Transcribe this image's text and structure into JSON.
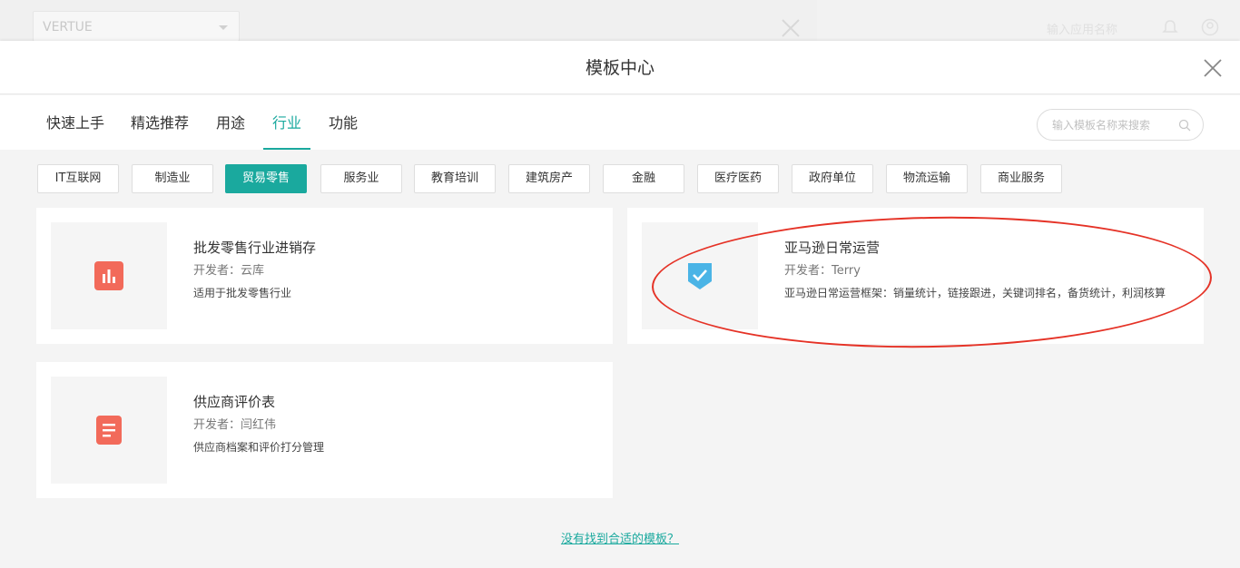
{
  "background": {
    "app_selector": "VERTUE",
    "search_placeholder": "输入应用名称"
  },
  "modal": {
    "title": "模板中心"
  },
  "tabs": [
    {
      "label": "快速上手"
    },
    {
      "label": "精选推荐"
    },
    {
      "label": "用途"
    },
    {
      "label": "行业",
      "active": true
    },
    {
      "label": "功能"
    }
  ],
  "search": {
    "placeholder": "输入模板名称来搜索"
  },
  "categories": [
    {
      "label": "IT互联网"
    },
    {
      "label": "制造业"
    },
    {
      "label": "贸易零售",
      "active": true
    },
    {
      "label": "服务业"
    },
    {
      "label": "教育培训"
    },
    {
      "label": "建筑房产"
    },
    {
      "label": "金融"
    },
    {
      "label": "医疗医药"
    },
    {
      "label": "政府单位"
    },
    {
      "label": "物流运输"
    },
    {
      "label": "商业服务"
    }
  ],
  "templates": [
    {
      "title": "批发零售行业进销存",
      "developer": "开发者：云库",
      "description": "适用于批发零售行业",
      "icon": "bar-chart-icon",
      "icon_color": "#f26a5a"
    },
    {
      "title": "亚马逊日常运营",
      "developer": "开发者：Terry",
      "description": "亚马逊日常运营框架：销量统计，链接跟进，关键词排名，备货统计，利润核算",
      "icon": "shield-check-icon",
      "icon_color": "#4ab4e6"
    },
    {
      "title": "供应商评价表",
      "developer": "开发者：闫红伟",
      "description": "供应商档案和评价打分管理",
      "icon": "document-icon",
      "icon_color": "#f26a5a"
    }
  ],
  "help_link": "没有找到合适的模板？",
  "colors": {
    "accent": "#1aa99e",
    "annotation": "#e53226"
  }
}
